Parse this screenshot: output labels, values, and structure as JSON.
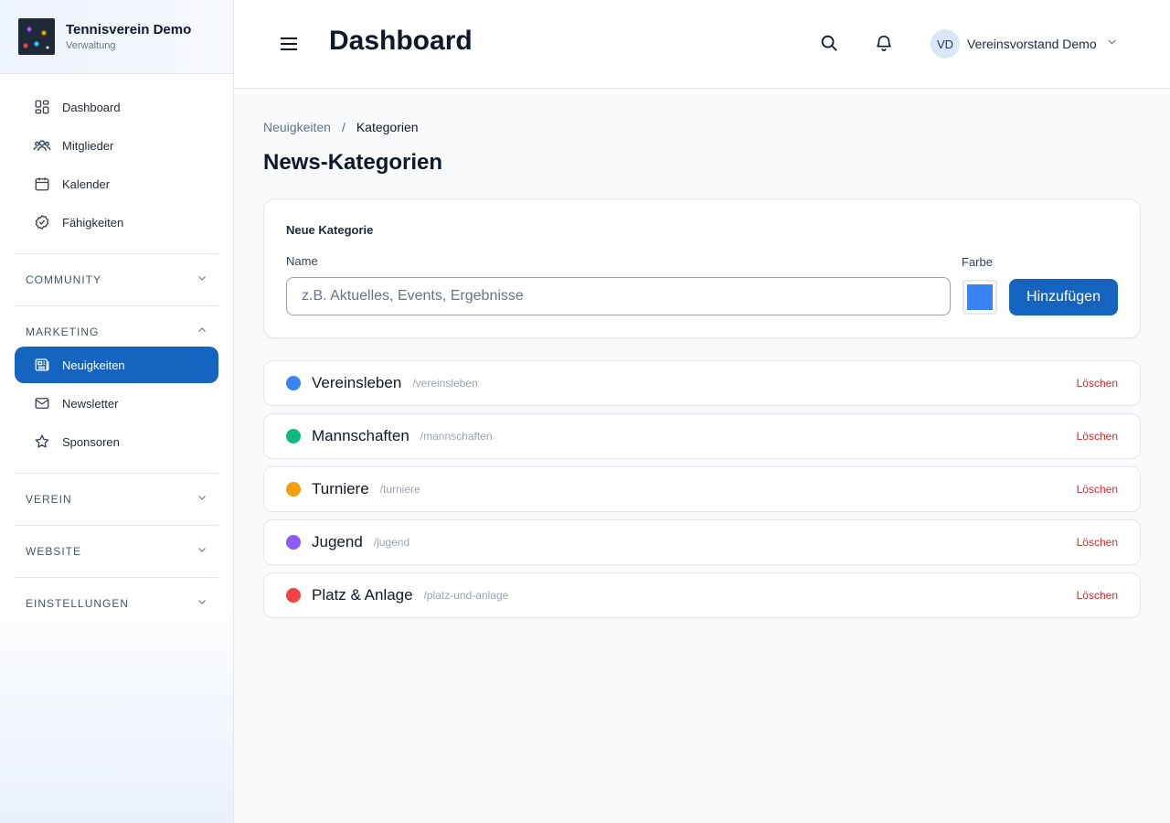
{
  "brand": {
    "title": "Tennisverein Demo",
    "subtitle": "Verwaltung"
  },
  "sidebar": {
    "top_items": [
      {
        "label": "Dashboard",
        "icon": "dashboard-icon"
      },
      {
        "label": "Mitglieder",
        "icon": "members-icon"
      },
      {
        "label": "Kalender",
        "icon": "calendar-icon"
      },
      {
        "label": "Fähigkeiten",
        "icon": "badge-check-icon"
      }
    ],
    "sections": {
      "community": "COMMUNITY",
      "marketing": "MARKETING",
      "verein": "VEREIN",
      "website": "WEBSITE",
      "einstellungen": "EINSTELLUNGEN"
    },
    "marketing_items": [
      {
        "label": "Neuigkeiten",
        "icon": "newspaper-icon",
        "active": true
      },
      {
        "label": "Newsletter",
        "icon": "mail-icon"
      },
      {
        "label": "Sponsoren",
        "icon": "star-icon"
      }
    ]
  },
  "header": {
    "title": "Dashboard",
    "user": {
      "initials": "VD",
      "name": "Vereinsvorstand Demo"
    }
  },
  "breadcrumb": {
    "parent": "Neuigkeiten",
    "separator": "/",
    "current": "Kategorien"
  },
  "page": {
    "title": "News-Kategorien"
  },
  "form": {
    "title": "Neue Kategorie",
    "name_label": "Name",
    "name_placeholder": "z.B. Aktuelles, Events, Ergebnisse",
    "name_value": "",
    "color_label": "Farbe",
    "color_value": "#3b82f6",
    "submit_label": "Hinzufügen"
  },
  "categories": [
    {
      "name": "Vereinsleben",
      "slug": "/vereinsleben",
      "color": "#3b82f6",
      "delete_label": "Löschen"
    },
    {
      "name": "Mannschaften",
      "slug": "/mannschaften",
      "color": "#10b981",
      "delete_label": "Löschen"
    },
    {
      "name": "Turniere",
      "slug": "/turniere",
      "color": "#f59e0b",
      "delete_label": "Löschen"
    },
    {
      "name": "Jugend",
      "slug": "/jugend",
      "color": "#8b5cf6",
      "delete_label": "Löschen"
    },
    {
      "name": "Platz & Anlage",
      "slug": "/platz-und-anlage",
      "color": "#ef4444",
      "delete_label": "Löschen"
    }
  ],
  "colors": {
    "primary": "#1565c0",
    "danger": "#dc2626"
  }
}
